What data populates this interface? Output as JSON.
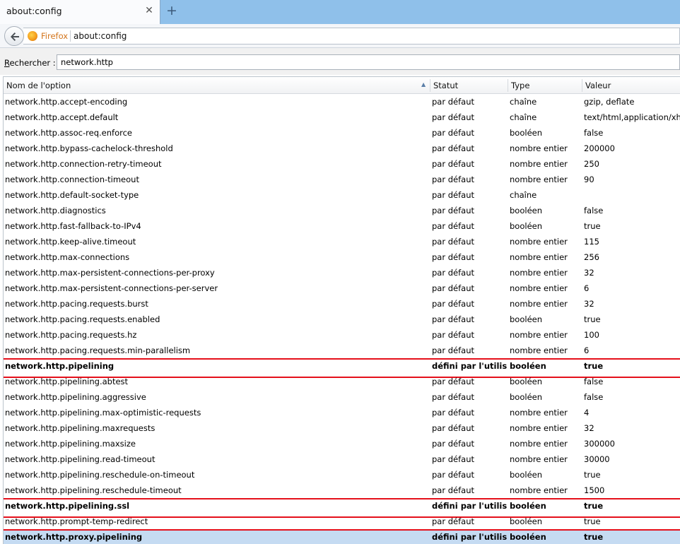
{
  "tab": {
    "title": "about:config"
  },
  "navbar": {
    "identity": "Firefox",
    "url": "about:config"
  },
  "search": {
    "label_prefix": "R",
    "label_rest": "echercher :",
    "value": "network.http"
  },
  "table": {
    "columns": {
      "name": "Nom de l'option",
      "status": "Statut",
      "type": "Type",
      "value": "Valeur"
    },
    "rows": [
      {
        "name": "network.http.accept-encoding",
        "status": "par défaut",
        "type": "chaîne",
        "value": "gzip, deflate"
      },
      {
        "name": "network.http.accept.default",
        "status": "par défaut",
        "type": "chaîne",
        "value": "text/html,application/xhtml+xml"
      },
      {
        "name": "network.http.assoc-req.enforce",
        "status": "par défaut",
        "type": "booléen",
        "value": "false"
      },
      {
        "name": "network.http.bypass-cachelock-threshold",
        "status": "par défaut",
        "type": "nombre entier",
        "value": "200000"
      },
      {
        "name": "network.http.connection-retry-timeout",
        "status": "par défaut",
        "type": "nombre entier",
        "value": "250"
      },
      {
        "name": "network.http.connection-timeout",
        "status": "par défaut",
        "type": "nombre entier",
        "value": "90"
      },
      {
        "name": "network.http.default-socket-type",
        "status": "par défaut",
        "type": "chaîne",
        "value": ""
      },
      {
        "name": "network.http.diagnostics",
        "status": "par défaut",
        "type": "booléen",
        "value": "false"
      },
      {
        "name": "network.http.fast-fallback-to-IPv4",
        "status": "par défaut",
        "type": "booléen",
        "value": "true"
      },
      {
        "name": "network.http.keep-alive.timeout",
        "status": "par défaut",
        "type": "nombre entier",
        "value": "115"
      },
      {
        "name": "network.http.max-connections",
        "status": "par défaut",
        "type": "nombre entier",
        "value": "256"
      },
      {
        "name": "network.http.max-persistent-connections-per-proxy",
        "status": "par défaut",
        "type": "nombre entier",
        "value": "32"
      },
      {
        "name": "network.http.max-persistent-connections-per-server",
        "status": "par défaut",
        "type": "nombre entier",
        "value": "6"
      },
      {
        "name": "network.http.pacing.requests.burst",
        "status": "par défaut",
        "type": "nombre entier",
        "value": "32"
      },
      {
        "name": "network.http.pacing.requests.enabled",
        "status": "par défaut",
        "type": "booléen",
        "value": "true"
      },
      {
        "name": "network.http.pacing.requests.hz",
        "status": "par défaut",
        "type": "nombre entier",
        "value": "100"
      },
      {
        "name": "network.http.pacing.requests.min-parallelism",
        "status": "par défaut",
        "type": "nombre entier",
        "value": "6"
      },
      {
        "name": "network.http.pipelining",
        "status": "défini par l'utilisa...",
        "type": "booléen",
        "value": "true",
        "user_set": true,
        "highlighted": true
      },
      {
        "name": "network.http.pipelining.abtest",
        "status": "par défaut",
        "type": "booléen",
        "value": "false"
      },
      {
        "name": "network.http.pipelining.aggressive",
        "status": "par défaut",
        "type": "booléen",
        "value": "false"
      },
      {
        "name": "network.http.pipelining.max-optimistic-requests",
        "status": "par défaut",
        "type": "nombre entier",
        "value": "4"
      },
      {
        "name": "network.http.pipelining.maxrequests",
        "status": "par défaut",
        "type": "nombre entier",
        "value": "32"
      },
      {
        "name": "network.http.pipelining.maxsize",
        "status": "par défaut",
        "type": "nombre entier",
        "value": "300000"
      },
      {
        "name": "network.http.pipelining.read-timeout",
        "status": "par défaut",
        "type": "nombre entier",
        "value": "30000"
      },
      {
        "name": "network.http.pipelining.reschedule-on-timeout",
        "status": "par défaut",
        "type": "booléen",
        "value": "true"
      },
      {
        "name": "network.http.pipelining.reschedule-timeout",
        "status": "par défaut",
        "type": "nombre entier",
        "value": "1500"
      },
      {
        "name": "network.http.pipelining.ssl",
        "status": "défini par l'utilisa...",
        "type": "booléen",
        "value": "true",
        "user_set": true,
        "highlighted": true
      },
      {
        "name": "network.http.prompt-temp-redirect",
        "status": "par défaut",
        "type": "booléen",
        "value": "true"
      },
      {
        "name": "network.http.proxy.pipelining",
        "status": "défini par l'utilisa...",
        "type": "booléen",
        "value": "true",
        "user_set": true,
        "highlighted": true,
        "selected": true
      }
    ]
  },
  "colors": {
    "highlight_border": "#e5101b",
    "selected_row": "#c5dbf2",
    "tabstrip": "#8fc0ea",
    "identity": "#d3741a"
  },
  "icons": {
    "back": "back-arrow-icon",
    "firefox": "firefox-icon",
    "close": "close-icon",
    "new_tab": "plus-icon",
    "sort": "sort-ascending-icon"
  }
}
